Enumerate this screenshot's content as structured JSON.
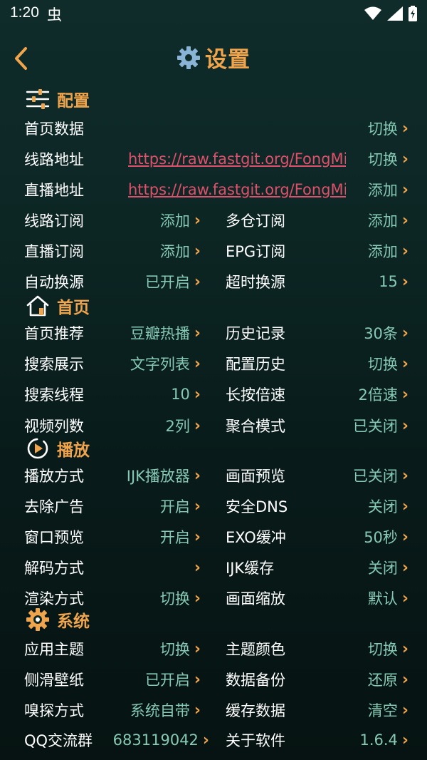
{
  "status_bar": {
    "time": "1:20",
    "bug_glyph": "虫"
  },
  "header": {
    "title": "设置"
  },
  "sections": {
    "config": "配置",
    "home": "首页",
    "play": "播放",
    "system": "系统"
  },
  "config": {
    "home_data": {
      "label": "首页数据",
      "value": "切换"
    },
    "line_addr": {
      "label": "线路地址",
      "url": "https://raw.fastgit.org/FongMi/",
      "value": "切换"
    },
    "live_addr": {
      "label": "直播地址",
      "url": "https://raw.fastgit.org/FongMi/",
      "value": "添加"
    },
    "line_sub": {
      "label": "线路订阅",
      "value": "添加"
    },
    "multi_sub": {
      "label": "多仓订阅",
      "value": "添加"
    },
    "live_sub": {
      "label": "直播订阅",
      "value": "添加"
    },
    "epg_sub": {
      "label": "EPG订阅",
      "value": "添加"
    },
    "auto_switch": {
      "label": "自动换源",
      "value": "已开启"
    },
    "timeout_switch": {
      "label": "超时换源",
      "value": "15"
    }
  },
  "home": {
    "recommend": {
      "label": "首页推荐",
      "value": "豆瓣热播"
    },
    "history": {
      "label": "历史记录",
      "value": "30条"
    },
    "search_display": {
      "label": "搜索展示",
      "value": "文字列表"
    },
    "config_history": {
      "label": "配置历史",
      "value": "切换"
    },
    "search_threads": {
      "label": "搜索线程",
      "value": "10"
    },
    "long_press_speed": {
      "label": "长按倍速",
      "value": "2倍速"
    },
    "video_columns": {
      "label": "视频列数",
      "value": "2列"
    },
    "aggregate_mode": {
      "label": "聚合模式",
      "value": "已关闭"
    }
  },
  "play": {
    "play_mode": {
      "label": "播放方式",
      "value": "IJK播放器"
    },
    "preview": {
      "label": "画面预览",
      "value": "已关闭"
    },
    "remove_ads": {
      "label": "去除广告",
      "value": "开启"
    },
    "safe_dns": {
      "label": "安全DNS",
      "value": "关闭"
    },
    "window_preview": {
      "label": "窗口预览",
      "value": "开启"
    },
    "exo_buffer": {
      "label": "EXO缓冲",
      "value": "50秒"
    },
    "decode_mode": {
      "label": "解码方式",
      "value": ""
    },
    "ijk_cache": {
      "label": "IJK缓存",
      "value": "关闭"
    },
    "render_mode": {
      "label": "渲染方式",
      "value": "切换"
    },
    "scale": {
      "label": "画面缩放",
      "value": "默认"
    }
  },
  "system": {
    "app_theme": {
      "label": "应用主题",
      "value": "切换"
    },
    "theme_color": {
      "label": "主题颜色",
      "value": "切换"
    },
    "side_wallpaper": {
      "label": "侧滑壁纸",
      "value": "已开启"
    },
    "data_backup": {
      "label": "数据备份",
      "value": "还原"
    },
    "sniff_mode": {
      "label": "嗅探方式",
      "value": "系统自带"
    },
    "cache_data": {
      "label": "缓存数据",
      "value": "清空"
    },
    "qq_group": {
      "label": "QQ交流群",
      "value": "683119042"
    },
    "about": {
      "label": "关于软件",
      "value": "1.6.4"
    }
  },
  "chevron": "›",
  "colors": {
    "accent": "#f0a44c",
    "value": "#86c9b4",
    "link": "#e0506a",
    "bg_top": "#0f2c2a",
    "bg_bottom": "#061312"
  },
  "icons": [
    "back-arrow-icon",
    "gear-icon",
    "sliders-icon",
    "home-icon",
    "play-icon",
    "wifi-icon",
    "signal-icon",
    "battery-icon"
  ]
}
